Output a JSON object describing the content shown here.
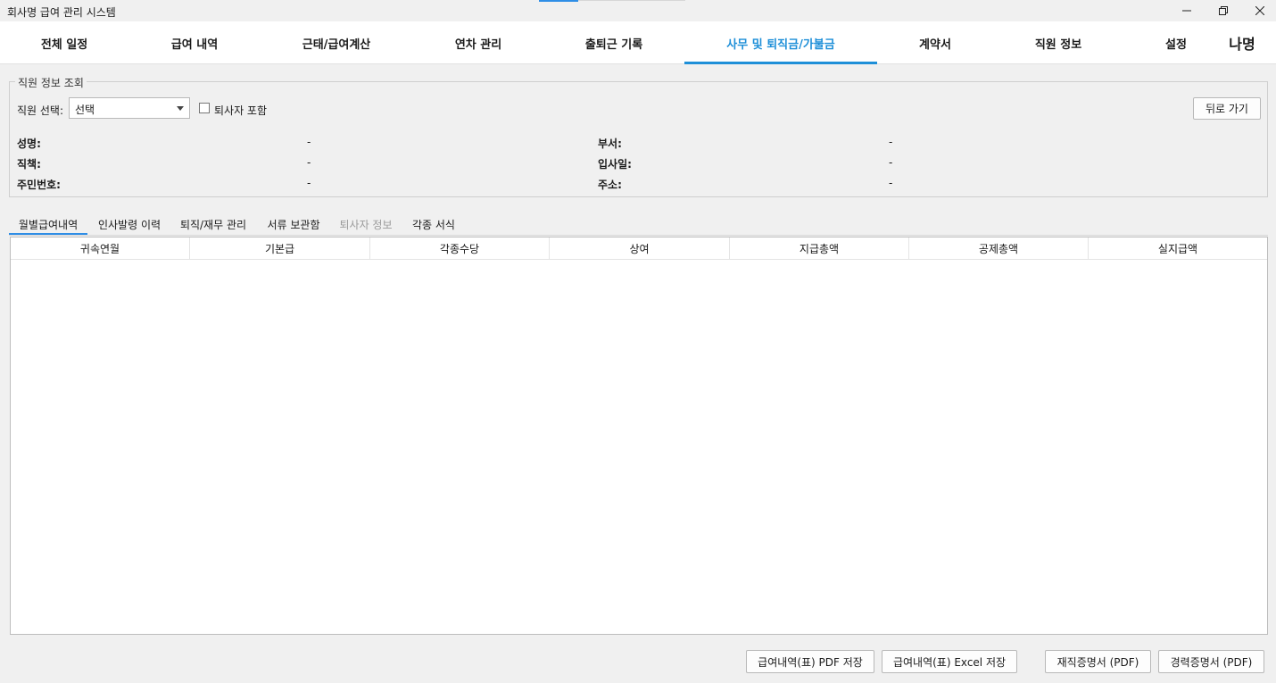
{
  "window": {
    "title": "회사명 급여 관리 시스템",
    "minimize_icon": "minimize-icon",
    "restore_icon": "restore-icon",
    "close_icon": "close-icon"
  },
  "topnav": {
    "items": [
      {
        "label": "전체 일정"
      },
      {
        "label": "급여 내역"
      },
      {
        "label": "근태/급여계산"
      },
      {
        "label": "연차 관리"
      },
      {
        "label": "출퇴근 기록"
      },
      {
        "label": "사무 및 퇴직금/가불금"
      },
      {
        "label": "계약서"
      },
      {
        "label": "직원 정보"
      },
      {
        "label": "설정"
      }
    ],
    "active_index": 5,
    "logo_text": "나명",
    "accent_color": "#1e8fd8"
  },
  "employee_group": {
    "legend": "직원 정보 조회",
    "select_label": "직원 선택:",
    "select_value": "선택",
    "include_retired_label": "퇴사자 포함",
    "include_retired_checked": false,
    "back_button": "뒤로 가기",
    "fields": {
      "name_label": "성명:",
      "name_value": "-",
      "position_label": "직책:",
      "position_value": "-",
      "resident_label": "주민번호:",
      "resident_value": "-",
      "dept_label": "부서:",
      "dept_value": "-",
      "hire_label": "입사일:",
      "hire_value": "-",
      "address_label": "주소:",
      "address_value": "-"
    }
  },
  "subtabs": {
    "items": [
      {
        "label": "월별급여내역"
      },
      {
        "label": "인사발령 이력"
      },
      {
        "label": "퇴직/재무 관리"
      },
      {
        "label": "서류 보관함"
      },
      {
        "label": "퇴사자 정보"
      },
      {
        "label": "각종 서식"
      }
    ],
    "active_index": 0,
    "disabled_index": 4
  },
  "table": {
    "columns": [
      "귀속연월",
      "기본급",
      "각종수당",
      "상여",
      "지급총액",
      "공제총액",
      "실지급액"
    ],
    "rows": []
  },
  "footer": {
    "pdf_button": "급여내역(표) PDF 저장",
    "excel_button": "급여내역(표) Excel 저장",
    "employment_cert_button": "재직증명서 (PDF)",
    "career_cert_button": "경력증명서 (PDF)"
  }
}
